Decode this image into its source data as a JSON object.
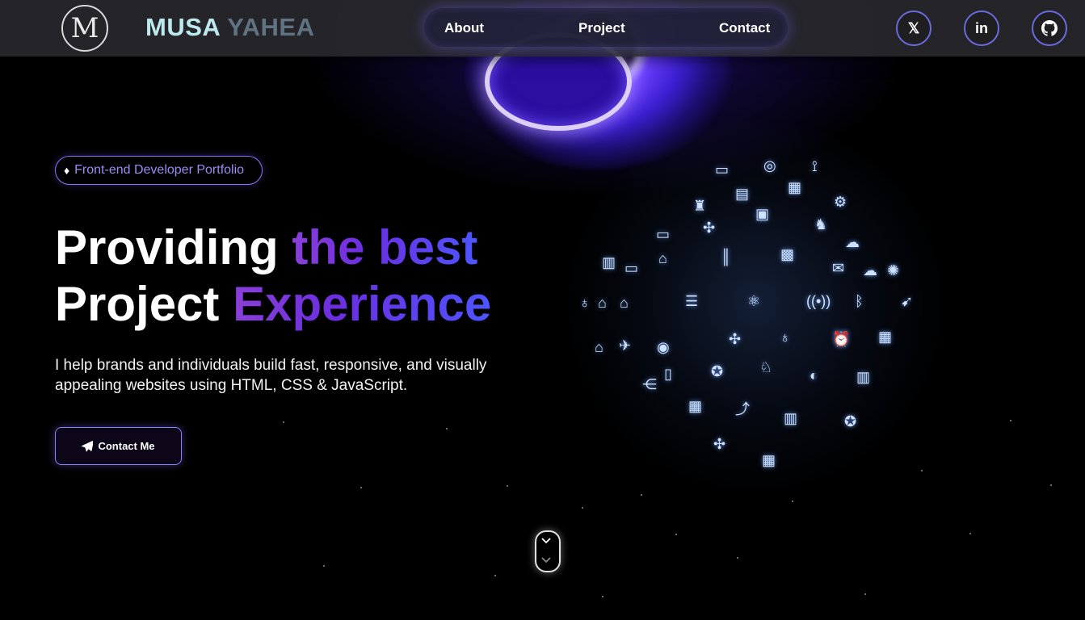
{
  "brand": {
    "logo_letter": "M",
    "first_name": "MUSA",
    "last_name": "YAHEA"
  },
  "nav": {
    "links": [
      "About",
      "Project",
      "Contact"
    ]
  },
  "social": {
    "twitter": "x-icon",
    "linkedin": "linkedin-icon",
    "github": "github-icon",
    "twitter_glyph": "𝕏",
    "linkedin_glyph": "in"
  },
  "hero": {
    "badge": "Front-end Developer Portfolio",
    "headline_line1_plain": "Providing ",
    "headline_line1_accent": "the best",
    "headline_line2_plain": "Project ",
    "headline_line2_accent": "Experience",
    "description": "I help brands and individuals build fast, responsive, and visually appealing websites using HTML, CSS & JavaScript.",
    "cta_label": "Contact Me"
  },
  "colors": {
    "accent_purple": "#7a3ae0",
    "accent_blue": "#4d55ff",
    "nav_bg": "#28282c",
    "brand_first": "#bde8ee",
    "brand_last": "#5f7383"
  }
}
